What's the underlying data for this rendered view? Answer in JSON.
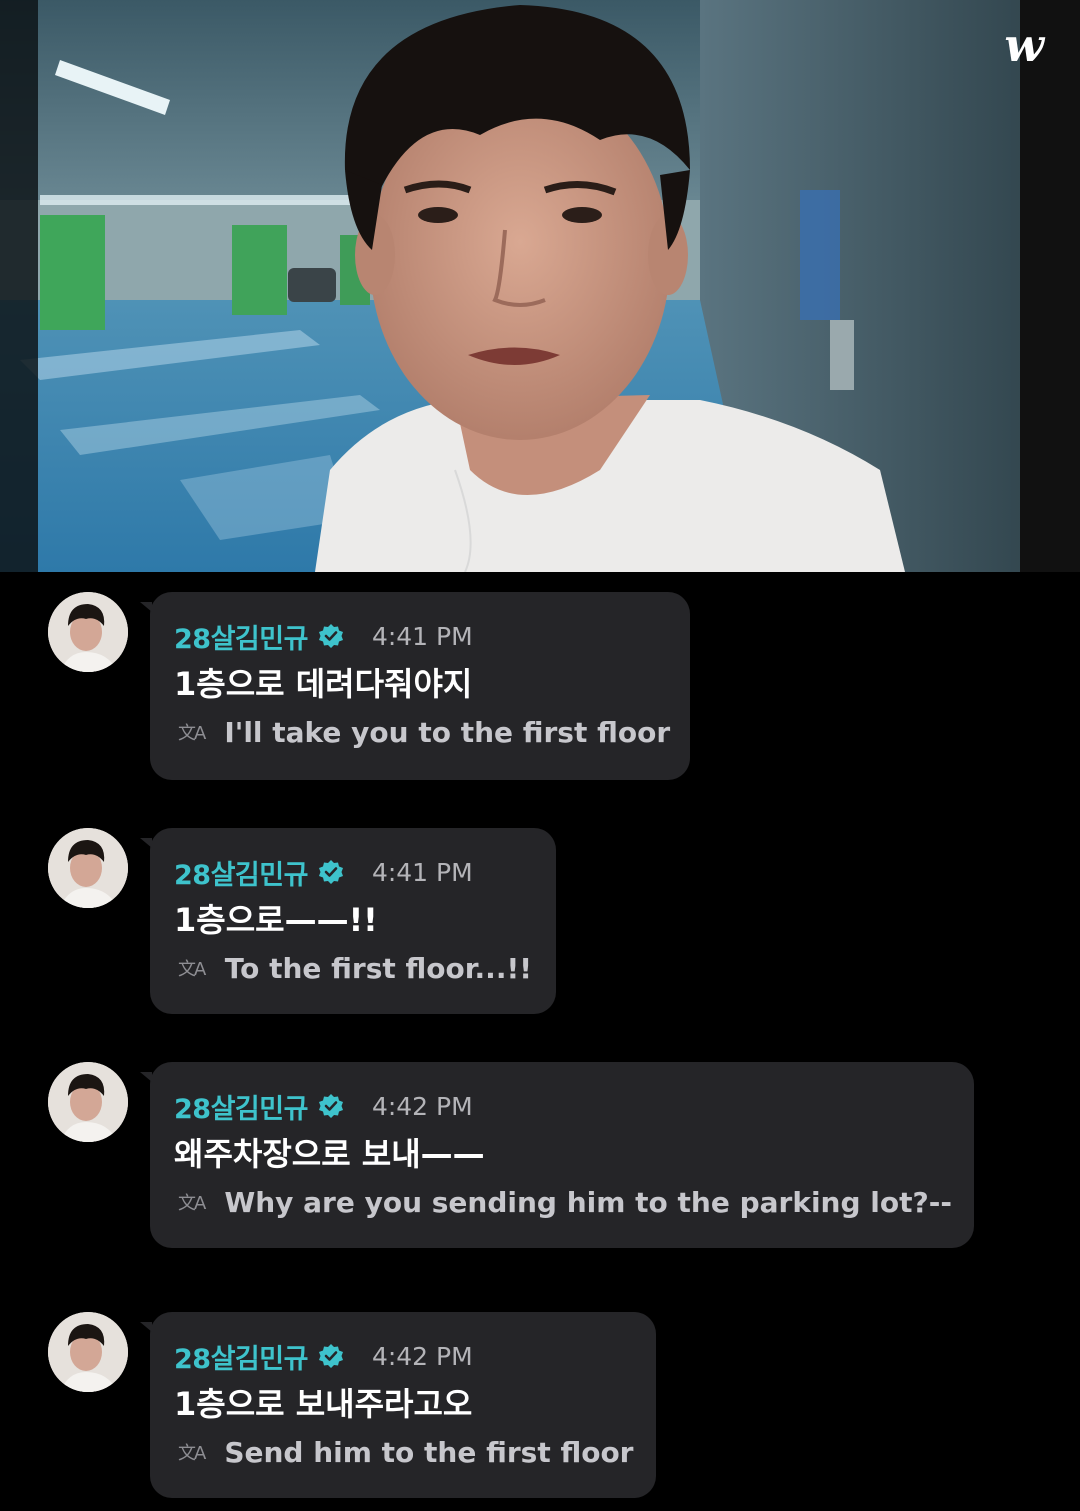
{
  "video": {
    "brand_logo": "w",
    "scene": "underground-parking-garage"
  },
  "icons": {
    "verified": "verified-badge-icon",
    "translate": "translate-icon",
    "translate_glyph": "文A"
  },
  "colors": {
    "username": "#3ec3cc",
    "bubble": "#252528",
    "background": "#000000"
  },
  "messages": [
    {
      "username": "28살김민규",
      "time": "4:41 PM",
      "text": "1층으로 데려다줘야지",
      "translation": "I'll take you to the first floor"
    },
    {
      "username": "28살김민규",
      "time": "4:41 PM",
      "text": "1층으로——!!",
      "translation": "To the first floor...!!"
    },
    {
      "username": "28살김민규",
      "time": "4:42 PM",
      "text": "왜주차장으로 보내——",
      "translation": "Why are you sending him to the parking lot?--"
    },
    {
      "username": "28살김민규",
      "time": "4:42 PM",
      "text": "1층으로 보내주라고오",
      "translation": "Send him to the first floor"
    }
  ]
}
